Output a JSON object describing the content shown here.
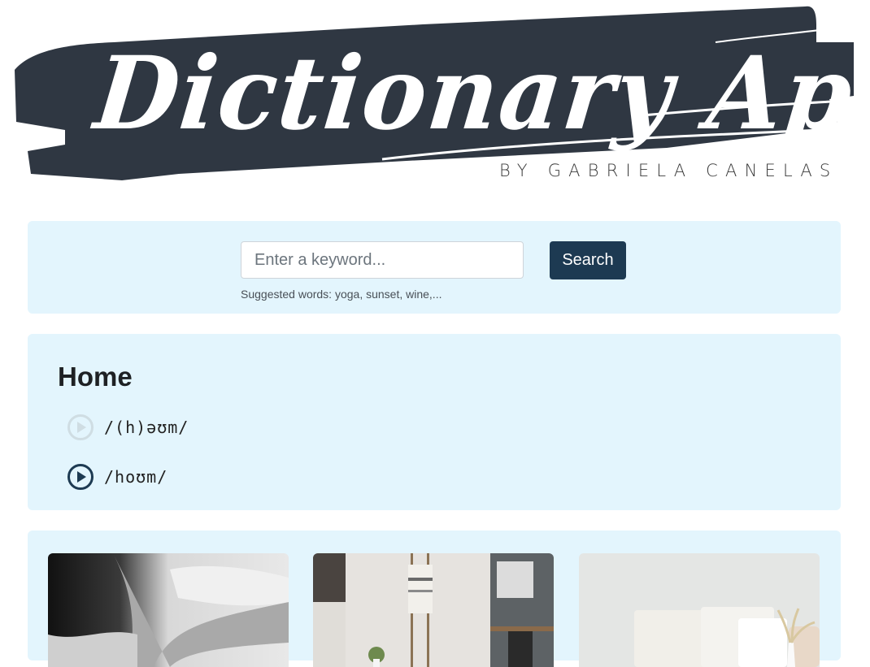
{
  "header": {
    "title": "Dictionary App",
    "byline": "BY GABRIELA CANELAS",
    "brush_color": "#2f3742"
  },
  "search": {
    "placeholder": "Enter a keyword...",
    "value": "",
    "button_label": "Search",
    "hint": "Suggested words: yoga, sunset, wine,...",
    "accent": "#1d3a52"
  },
  "result": {
    "word": "Home",
    "phonetics": [
      {
        "text": "/(h)əʊm/",
        "audio_available": false,
        "icon": "play-circle-icon"
      },
      {
        "text": "/hoʊm/",
        "audio_available": true,
        "icon": "play-circle-icon"
      }
    ]
  },
  "photos": {
    "items": [
      {
        "description": "black and white photo of people lying on a bed"
      },
      {
        "description": "room with a towel hanging on a ladder and a small plant"
      },
      {
        "description": "white pillows on a bed with dried flowers in a vase"
      }
    ]
  },
  "colors": {
    "panel_bg": "#e3f5fd",
    "disabled_icon": "#cfdde3",
    "active_icon": "#1d3a52"
  }
}
